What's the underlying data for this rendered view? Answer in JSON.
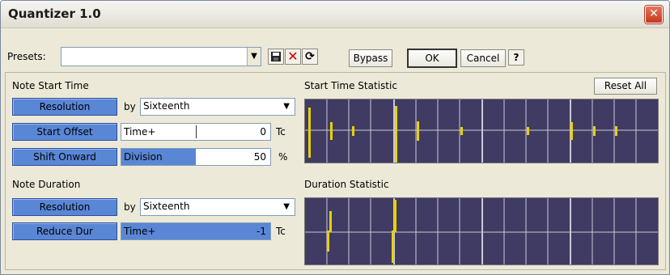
{
  "window": {
    "title": "Quantizer 1.0"
  },
  "toolbar": {
    "presets_label": "Presets:",
    "presets_value": "",
    "bypass_label": "Bypass",
    "ok_label": "OK",
    "cancel_label": "Cancel",
    "help_label": "?"
  },
  "start": {
    "heading": "Note Start Time",
    "resolution_label": "Resolution",
    "by_label": "by",
    "resolution_value": "Sixteenth",
    "offset_label": "Start Offset",
    "offset_mode": "Time+",
    "offset_value": "0",
    "offset_unit": "Tc",
    "shift_label": "Shift Onward",
    "shift_mode": "Division",
    "shift_value": "50",
    "shift_unit": "%",
    "shift_fraction": 0.5
  },
  "duration": {
    "heading": "Note Duration",
    "resolution_label": "Resolution",
    "by_label": "by",
    "resolution_value": "Sixteenth",
    "reduce_label": "Reduce Dur",
    "reduce_mode": "Time+",
    "reduce_value": "-1",
    "reduce_unit": "Tc"
  },
  "stats": {
    "start_title": "Start Time Statistic",
    "reset_label": "Reset All",
    "duration_title": "Duration Statistic"
  },
  "colors": {
    "graph_bg": "#3f3b63",
    "grid": "#c8c8d8",
    "marker": "#e8d200",
    "button_blue": "#5a86d6"
  }
}
